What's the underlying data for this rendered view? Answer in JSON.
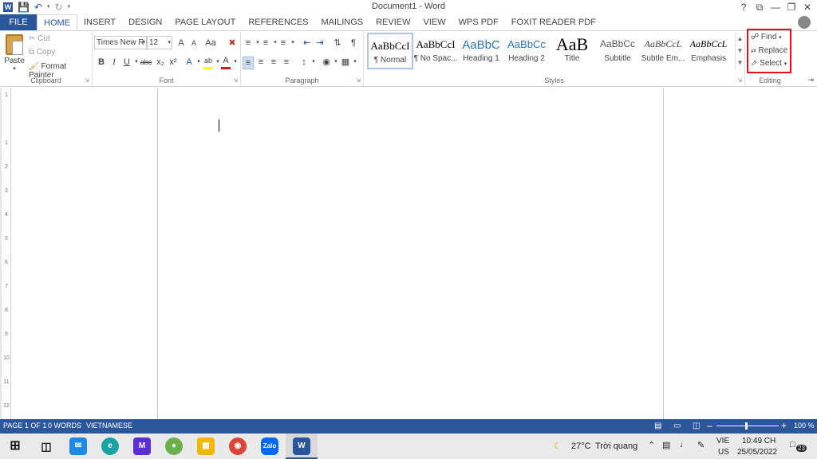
{
  "window": {
    "title": "Document1 - Word",
    "controls": [
      "?",
      "⧉",
      "—",
      "❐",
      "✕"
    ]
  },
  "qat": {
    "icons": [
      "word-app-icon",
      "save-icon",
      "undo-icon",
      "redo-icon",
      "customize-qat-icon"
    ]
  },
  "tabs": [
    "FILE",
    "HOME",
    "INSERT",
    "DESIGN",
    "PAGE LAYOUT",
    "REFERENCES",
    "MAILINGS",
    "REVIEW",
    "VIEW",
    "WPS PDF",
    "FOXIT READER PDF"
  ],
  "active_tab": "HOME",
  "clipboard": {
    "paste": "Paste",
    "cut": "Cut",
    "copy": "Copy",
    "format_painter": "Format Painter",
    "label": "Clipboard"
  },
  "font": {
    "name": "Times New R",
    "size": "12",
    "label": "Font",
    "buttons": [
      "A",
      "A",
      "Aa",
      "B",
      "I",
      "U",
      "abc",
      "x₂",
      "x²",
      "A",
      "ab",
      "A"
    ]
  },
  "paragraph": {
    "label": "Paragraph"
  },
  "styles": {
    "label": "Styles",
    "items": [
      {
        "preview": "AaBbCcI",
        "name": "¶ Normal"
      },
      {
        "preview": "AaBbCcI",
        "name": "¶ No Spac..."
      },
      {
        "preview": "AaBbC",
        "name": "Heading 1"
      },
      {
        "preview": "AaBbCc",
        "name": "Heading 2"
      },
      {
        "preview": "AaB",
        "name": "Title"
      },
      {
        "preview": "AaBbCc",
        "name": "Subtitle"
      },
      {
        "preview": "AaBbCcL",
        "name": "Subtle Em..."
      },
      {
        "preview": "AaBbCcL",
        "name": "Emphasis"
      }
    ]
  },
  "editing": {
    "find": "Find",
    "replace": "Replace",
    "select": "Select",
    "label": "Editing"
  },
  "ruler": {
    "numbers": [
      "1",
      "1",
      "2",
      "3",
      "4",
      "5",
      "6",
      "7",
      "8",
      "9",
      "10",
      "11",
      "12"
    ]
  },
  "status": {
    "page": "PAGE 1 OF 1",
    "words": "0 WORDS",
    "language": "VIETNAMESE",
    "zoom": "100 %",
    "zoom_level": 1.0
  },
  "taskbar": {
    "weather_temp": "27°C",
    "weather_text": "Trời quang",
    "lang_top": "VIE",
    "lang_bottom": "US",
    "time": "10:49 CH",
    "date": "25/05/2022",
    "notifications": "23",
    "apps": [
      "start-icon",
      "task-view-icon",
      "mail-icon",
      "edge-icon",
      "app-icon",
      "app-green-icon",
      "file-explorer-icon",
      "chrome-icon",
      "zalo-icon",
      "word-icon"
    ],
    "zalo_label": "Zalo",
    "word_label": "W"
  },
  "colors": {
    "brand": "#2b579a",
    "highlight_red": "#e0101a",
    "font_color_bar": "#e0101a",
    "highlight_bar": "#ffff00"
  }
}
